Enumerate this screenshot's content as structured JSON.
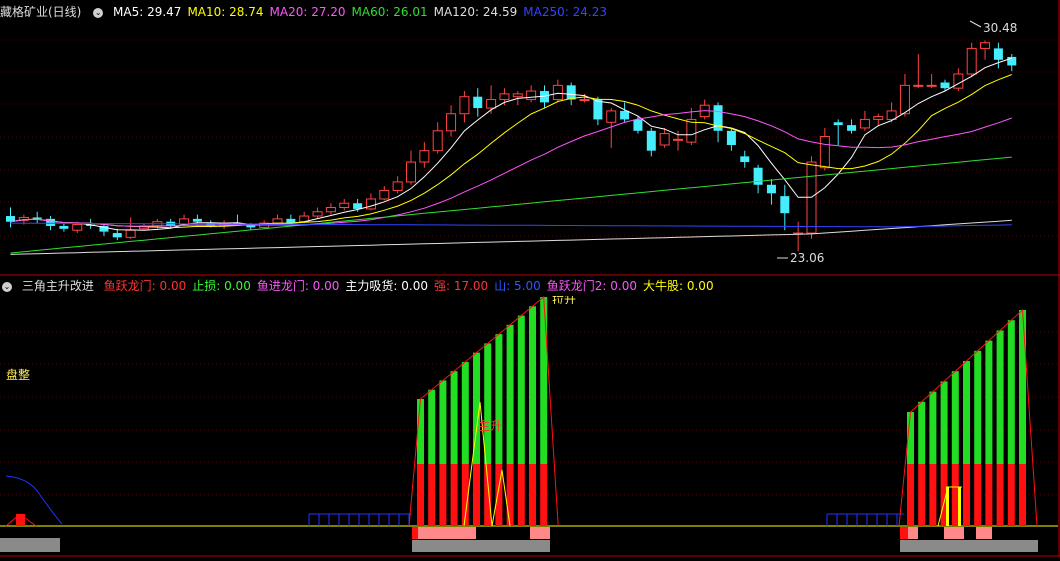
{
  "colors": {
    "ma5": "#ffffff",
    "ma10": "#ffff00",
    "ma20": "#ff55ff",
    "ma60": "#33dd33",
    "ma120": "#dddddd",
    "ma250": "#3344ff",
    "up": "#ff4444",
    "down": "#44eeff",
    "grid": "#550000",
    "bar_red": "#ff1111",
    "bar_green": "#22dd22",
    "blue": "#2233ff",
    "yellow": "#ffff00",
    "gray": "#8a8a8a"
  },
  "stock": {
    "title": "藏格矿业(日线)",
    "ma_labels": [
      {
        "label": "MA5: 29.47",
        "color": "#ffffff"
      },
      {
        "label": "MA10: 28.74",
        "color": "#ffff00"
      },
      {
        "label": "MA20: 27.20",
        "color": "#ff55ff"
      },
      {
        "label": "MA60: 26.01",
        "color": "#33dd33"
      },
      {
        "label": "MA120: 24.59",
        "color": "#dddddd"
      },
      {
        "label": "MA250: 24.23",
        "color": "#3344ff"
      }
    ],
    "high_label": "30.48",
    "low_label": "23.06"
  },
  "indicator": {
    "title": "三角主升改进",
    "values": [
      {
        "label": "鱼跃龙门: 0.00",
        "color": "#ff3333"
      },
      {
        "label": "止损: 0.00",
        "color": "#33ff33"
      },
      {
        "label": "鱼进龙门: 0.00",
        "color": "#ff55ff"
      },
      {
        "label": "主力吸货: 0.00",
        "color": "#ffffff"
      },
      {
        "label": "强: 17.00",
        "color": "#ff3333"
      },
      {
        "label": "山: 5.00",
        "color": "#3355ff"
      },
      {
        "label": "鱼跃龙门2: 0.00",
        "color": "#ff55ff"
      },
      {
        "label": "大牛股: 0.00",
        "color": "#ffff00"
      }
    ],
    "annotations": {
      "consolidation": "盘整",
      "main_rise": "主升",
      "top_cut": "拉升"
    }
  },
  "chart_data": {
    "type": "candlestick",
    "price_range": [
      22.4,
      31.2
    ],
    "candles": [
      [
        24.3,
        24.1,
        24.6,
        23.9
      ],
      [
        24.15,
        24.25,
        24.35,
        24.0
      ],
      [
        24.25,
        24.2,
        24.45,
        24.05
      ],
      [
        24.2,
        23.95,
        24.3,
        23.8
      ],
      [
        23.95,
        23.85,
        24.05,
        23.75
      ],
      [
        23.8,
        24.0,
        24.1,
        23.7
      ],
      [
        24.0,
        23.95,
        24.2,
        23.85
      ],
      [
        23.95,
        23.75,
        24.05,
        23.6
      ],
      [
        23.7,
        23.55,
        23.85,
        23.45
      ],
      [
        23.55,
        23.8,
        24.25,
        23.5
      ],
      [
        23.85,
        23.95,
        24.05,
        23.8
      ],
      [
        23.95,
        24.1,
        24.2,
        23.85
      ],
      [
        24.1,
        23.95,
        24.2,
        23.85
      ],
      [
        24.0,
        24.2,
        24.35,
        23.95
      ],
      [
        24.2,
        24.1,
        24.35,
        24.0
      ],
      [
        24.05,
        23.95,
        24.15,
        23.9
      ],
      [
        23.95,
        24.05,
        24.15,
        23.85
      ],
      [
        24.05,
        24.0,
        24.35,
        23.95
      ],
      [
        24.0,
        23.9,
        24.05,
        23.8
      ],
      [
        23.9,
        24.05,
        24.15,
        23.85
      ],
      [
        24.05,
        24.2,
        24.35,
        24.0
      ],
      [
        24.2,
        24.05,
        24.35,
        24.0
      ],
      [
        24.1,
        24.3,
        24.45,
        24.05
      ],
      [
        24.3,
        24.45,
        24.6,
        24.2
      ],
      [
        24.45,
        24.6,
        24.75,
        24.35
      ],
      [
        24.6,
        24.75,
        24.9,
        24.5
      ],
      [
        24.75,
        24.55,
        24.9,
        24.45
      ],
      [
        24.55,
        24.9,
        25.1,
        24.5
      ],
      [
        24.9,
        25.2,
        25.35,
        24.85
      ],
      [
        25.2,
        25.5,
        25.7,
        25.1
      ],
      [
        25.5,
        26.2,
        26.6,
        25.4
      ],
      [
        26.2,
        26.6,
        26.9,
        26.0
      ],
      [
        26.6,
        27.3,
        27.6,
        26.5
      ],
      [
        27.3,
        27.9,
        28.2,
        27.1
      ],
      [
        27.9,
        28.5,
        28.7,
        27.6
      ],
      [
        28.5,
        28.1,
        28.8,
        27.8
      ],
      [
        28.1,
        28.4,
        28.9,
        27.9
      ],
      [
        28.4,
        28.6,
        28.8,
        28.2
      ],
      [
        28.5,
        28.6,
        28.7,
        28.2
      ],
      [
        28.4,
        28.7,
        28.9,
        28.3
      ],
      [
        28.7,
        28.3,
        28.9,
        28.1
      ],
      [
        28.4,
        28.9,
        29.1,
        28.3
      ],
      [
        28.9,
        28.4,
        29.0,
        28.2
      ],
      [
        28.4,
        28.4,
        28.6,
        28.3
      ],
      [
        28.4,
        27.7,
        28.5,
        27.5
      ],
      [
        27.6,
        28.0,
        28.1,
        26.7
      ],
      [
        28.0,
        27.7,
        28.3,
        27.6
      ],
      [
        27.7,
        27.3,
        27.8,
        27.2
      ],
      [
        27.3,
        26.6,
        27.4,
        26.4
      ],
      [
        26.8,
        27.2,
        27.4,
        26.7
      ],
      [
        27.0,
        27.0,
        27.3,
        26.6
      ],
      [
        26.9,
        27.7,
        28.1,
        26.8
      ],
      [
        27.8,
        28.2,
        28.4,
        27.7
      ],
      [
        28.2,
        27.3,
        28.3,
        26.9
      ],
      [
        27.3,
        26.8,
        27.4,
        26.6
      ],
      [
        26.4,
        26.2,
        26.6,
        26.0
      ],
      [
        26.0,
        25.4,
        26.1,
        25.1
      ],
      [
        25.4,
        25.1,
        25.6,
        24.7
      ],
      [
        25.0,
        24.4,
        25.4,
        23.8
      ],
      [
        23.7,
        23.7,
        24.1,
        23.06
      ],
      [
        23.7,
        26.2,
        26.4,
        23.5
      ],
      [
        26.0,
        27.1,
        27.4,
        25.9
      ],
      [
        27.6,
        27.5,
        27.7,
        26.8
      ],
      [
        27.5,
        27.3,
        27.7,
        27.2
      ],
      [
        27.4,
        27.7,
        28.0,
        27.3
      ],
      [
        27.7,
        27.8,
        27.9,
        27.5
      ],
      [
        27.7,
        28.0,
        28.3,
        27.6
      ],
      [
        27.9,
        28.9,
        29.3,
        27.8
      ],
      [
        28.9,
        28.9,
        30.0,
        28.8
      ],
      [
        28.9,
        28.9,
        29.3,
        28.8
      ],
      [
        29.0,
        28.8,
        29.1,
        28.7
      ],
      [
        28.8,
        29.3,
        29.5,
        28.7
      ],
      [
        29.3,
        30.2,
        30.4,
        29.2
      ],
      [
        30.2,
        30.4,
        30.48,
        29.8
      ],
      [
        30.2,
        29.8,
        30.4,
        29.5
      ],
      [
        29.9,
        29.6,
        30.0,
        29.4
      ]
    ]
  }
}
